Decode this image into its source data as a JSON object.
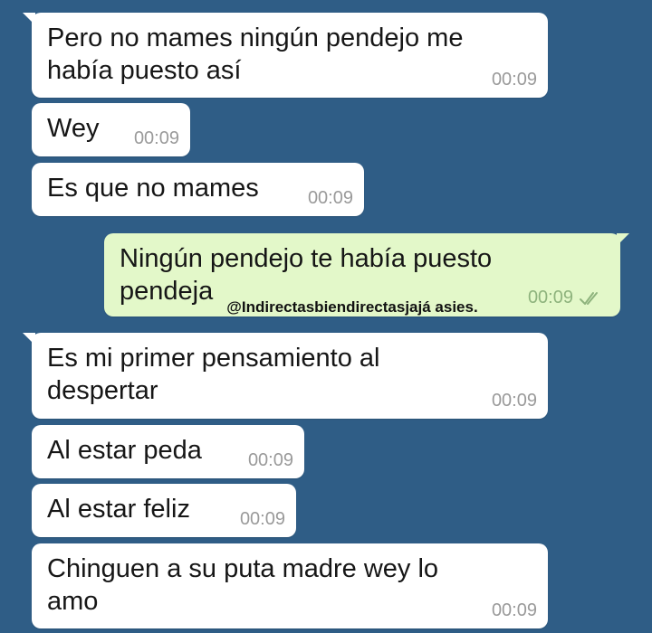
{
  "chat": {
    "messages": [
      {
        "direction": "incoming",
        "lines": [
          "Pero no mames ningún pendejo me",
          "había puesto así"
        ],
        "time": "00:09"
      },
      {
        "direction": "incoming",
        "lines": [
          "Wey"
        ],
        "time": "00:09"
      },
      {
        "direction": "incoming",
        "lines": [
          "Es que no mames"
        ],
        "time": "00:09"
      },
      {
        "direction": "outgoing",
        "lines": [
          "Ningún pendejo te había puesto",
          "pendeja"
        ],
        "time": "00:09",
        "status_icon": "double-check-icon"
      },
      {
        "direction": "incoming",
        "lines": [
          "Es mi primer pensamiento al",
          "despertar"
        ],
        "time": "00:09"
      },
      {
        "direction": "incoming",
        "lines": [
          "Al estar peda"
        ],
        "time": "00:09"
      },
      {
        "direction": "incoming",
        "lines": [
          "Al estar feliz"
        ],
        "time": "00:09"
      },
      {
        "direction": "incoming",
        "lines": [
          "Chinguen a su puta madre wey lo",
          "amo"
        ],
        "time": "00:09"
      }
    ],
    "watermark": "@Indirectasbiendirectasjajá asies."
  },
  "colors": {
    "background": "#2f5d86",
    "incoming_bubble": "#ffffff",
    "outgoing_bubble": "#e3f8c9",
    "text": "#161616",
    "time_incoming": "#9a9a9a",
    "time_outgoing": "#8eb37d"
  }
}
